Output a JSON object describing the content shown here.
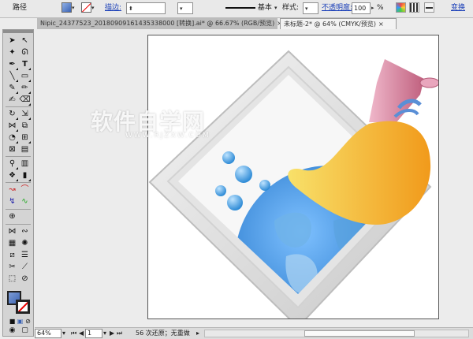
{
  "control_bar": {
    "mode_label": "路径",
    "stroke_label": "描边:",
    "stroke_value": "",
    "profile_label": "基本",
    "style_label": "样式:",
    "opacity_label": "不透明度:",
    "opacity_value": "100",
    "opacity_unit": "%",
    "transform_label": "变换"
  },
  "tabs": [
    {
      "label": "Nipic_24377523_20180909161435338000 [转换].ai* @ 66.67% (RGB/预览)",
      "active": false
    },
    {
      "label": "未标题-2* @ 64% (CMYK/预览)",
      "active": true
    }
  ],
  "status_bar": {
    "zoom": "64%",
    "page": "1",
    "history_text": "56 次还原；无重做"
  },
  "watermark": {
    "text": "软件自学网",
    "url": "WWW.RJZXW.COM"
  },
  "colors": {
    "accent_link": "#1a3fb8",
    "artwork_blue": "#2f7fd0",
    "brush_yellow": "#f6c93a",
    "brush_orange": "#f19a1b",
    "handle_pink": "#d98aa8",
    "band_blue": "#5a8fd6"
  }
}
